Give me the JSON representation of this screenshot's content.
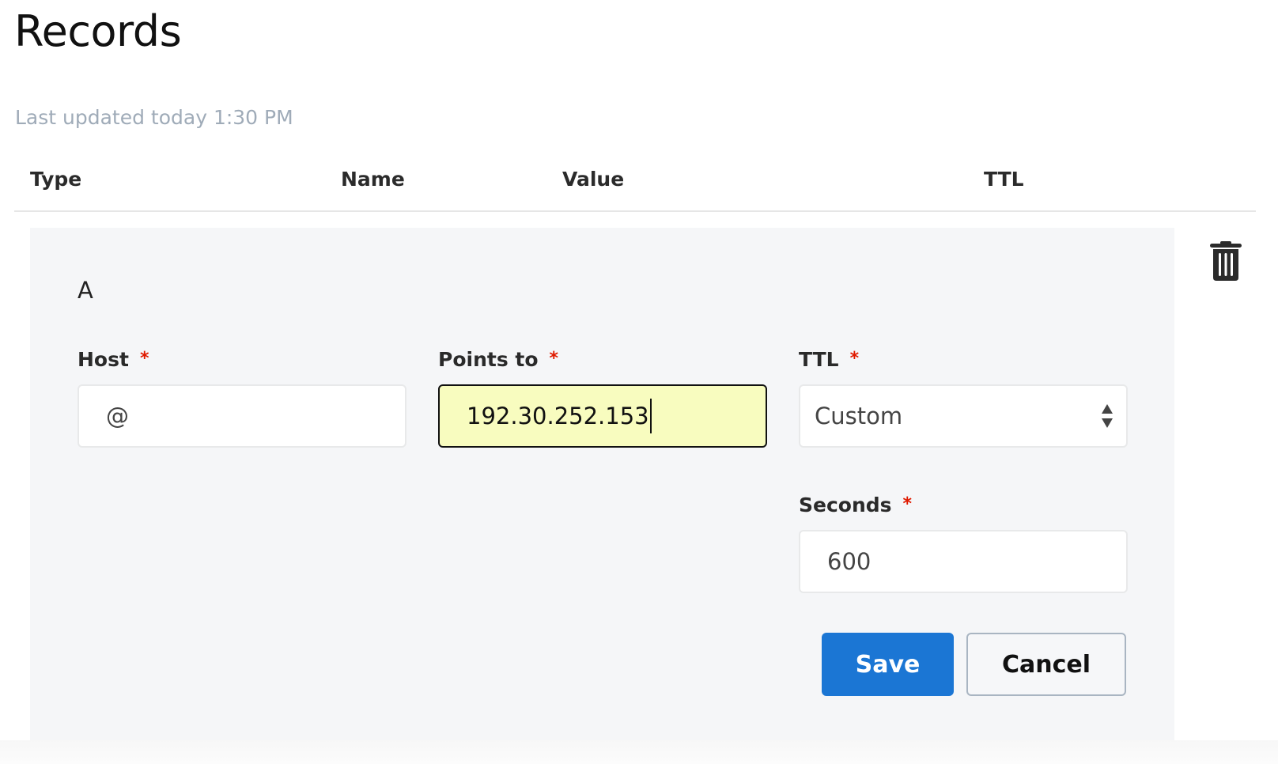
{
  "page": {
    "title": "Records",
    "last_updated": "Last updated today 1:30 PM"
  },
  "table": {
    "columns": [
      "Type",
      "Name",
      "Value",
      "TTL"
    ]
  },
  "record": {
    "type": "A",
    "delete_icon": "trash-icon",
    "fields": {
      "host": {
        "label": "Host",
        "required_mark": "*",
        "value": "@"
      },
      "points_to": {
        "label": "Points to",
        "required_mark": "*",
        "value": "192.30.252.153",
        "focused": true
      },
      "ttl": {
        "label": "TTL",
        "required_mark": "*",
        "selected": "Custom",
        "icon": "up-down-arrows-icon"
      },
      "seconds": {
        "label": "Seconds",
        "required_mark": "*",
        "value": "600"
      }
    },
    "actions": {
      "save_label": "Save",
      "cancel_label": "Cancel"
    }
  },
  "colors": {
    "accent": "#1b76d4",
    "required": "#e01a00",
    "focus_background": "#f8fcbf",
    "panel_background": "#f5f6f8",
    "muted_text": "#9fabb8"
  }
}
